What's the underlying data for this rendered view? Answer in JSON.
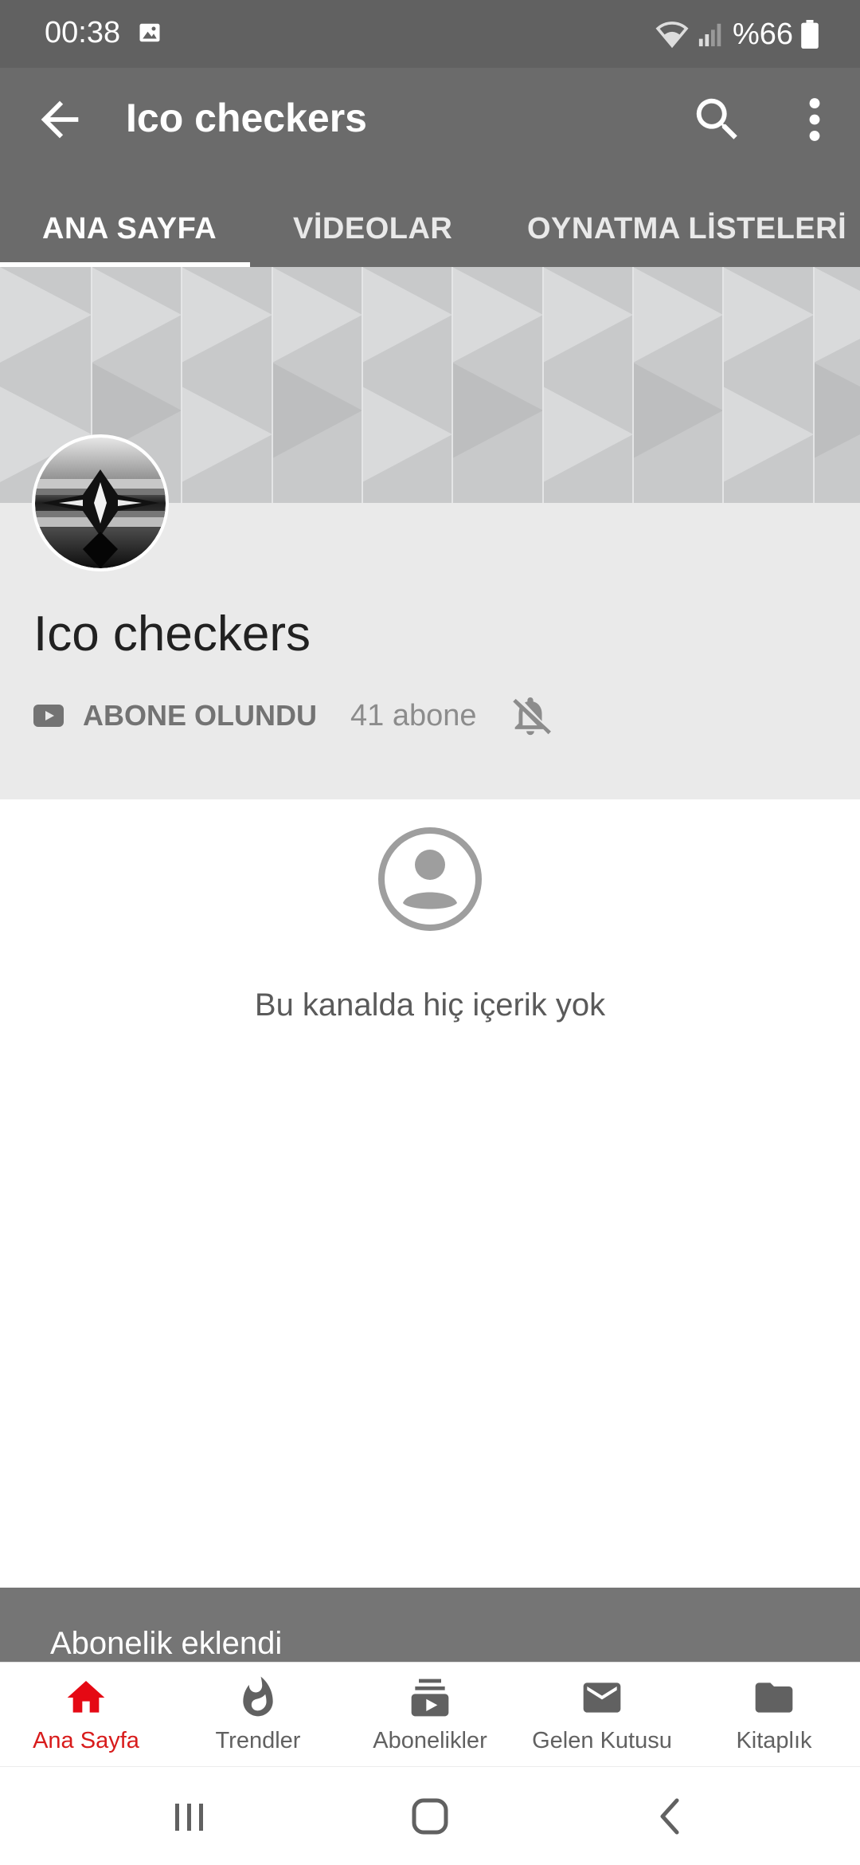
{
  "status_bar": {
    "time": "00:38",
    "battery": "%66"
  },
  "app_bar": {
    "title": "Ico checkers"
  },
  "tabs": [
    {
      "label": "ANA SAYFA",
      "active": true
    },
    {
      "label": "VİDEOLAR",
      "active": false
    },
    {
      "label": "OYNATMA LİSTELERİ",
      "active": false
    }
  ],
  "channel": {
    "name": "Ico checkers",
    "subscribed_label": "ABONE OLUNDU",
    "subscriber_count": "41 abone"
  },
  "empty_state": {
    "message": "Bu kanalda hiç içerik yok"
  },
  "snackbar": {
    "message": "Abonelik eklendi"
  },
  "bottom_nav": [
    {
      "label": "Ana Sayfa",
      "icon": "home-icon",
      "active": true
    },
    {
      "label": "Trendler",
      "icon": "flame-icon",
      "active": false
    },
    {
      "label": "Abonelikler",
      "icon": "subscriptions-icon",
      "active": false
    },
    {
      "label": "Gelen Kutusu",
      "icon": "mail-icon",
      "active": false
    },
    {
      "label": "Kitaplık",
      "icon": "folder-icon",
      "active": false
    }
  ],
  "colors": {
    "accent": "#d81b1b",
    "app_bar": "#6b6b6b",
    "status_bar": "#616161"
  }
}
